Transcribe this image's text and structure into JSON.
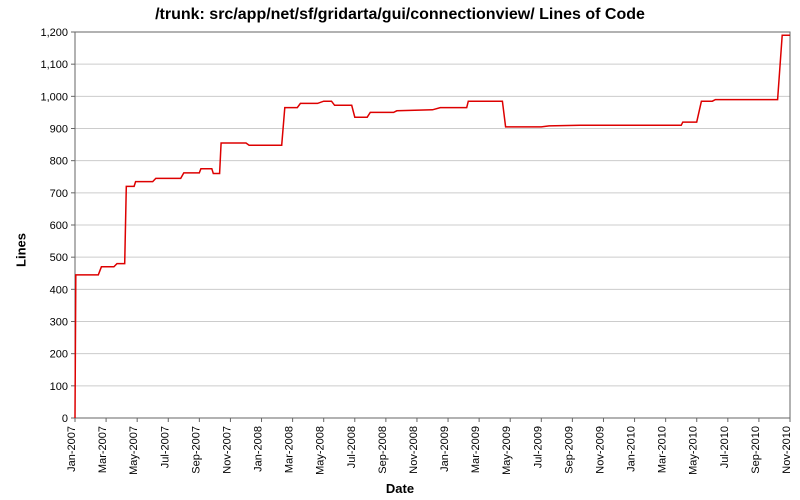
{
  "chart_data": {
    "type": "line",
    "title": "/trunk: src/app/net/sf/gridarta/gui/connectionview/ Lines of Code",
    "xlabel": "Date",
    "ylabel": "Lines",
    "ylim": [
      0,
      1200
    ],
    "yticks": [
      0,
      100,
      200,
      300,
      400,
      500,
      600,
      700,
      800,
      900,
      1000,
      1100,
      1200
    ],
    "ytick_labels": [
      "0",
      "100",
      "200",
      "300",
      "400",
      "500",
      "600",
      "700",
      "800",
      "900",
      "1,000",
      "1,100",
      "1,200"
    ],
    "xlim": [
      0,
      46
    ],
    "xticks": [
      0,
      2,
      4,
      6,
      8,
      10,
      12,
      14,
      16,
      18,
      20,
      22,
      24,
      26,
      28,
      30,
      32,
      34,
      36,
      38,
      40,
      42,
      44,
      46
    ],
    "xtick_labels": [
      "Jan-2007",
      "Mar-2007",
      "May-2007",
      "Jul-2007",
      "Sep-2007",
      "Nov-2007",
      "Jan-2008",
      "Mar-2008",
      "May-2008",
      "Jul-2008",
      "Sep-2008",
      "Nov-2008",
      "Jan-2009",
      "Mar-2009",
      "May-2009",
      "Jul-2009",
      "Sep-2009",
      "Nov-2009",
      "Jan-2010",
      "Mar-2010",
      "May-2010",
      "Jul-2010",
      "Sep-2010",
      "Nov-2010"
    ],
    "series": [
      {
        "name": "Lines of Code",
        "color": "#dd0000",
        "points": [
          {
            "x": 0.0,
            "y": 0
          },
          {
            "x": 0.05,
            "y": 445
          },
          {
            "x": 1.5,
            "y": 445
          },
          {
            "x": 1.7,
            "y": 470
          },
          {
            "x": 2.5,
            "y": 470
          },
          {
            "x": 2.7,
            "y": 480
          },
          {
            "x": 3.2,
            "y": 480
          },
          {
            "x": 3.3,
            "y": 720
          },
          {
            "x": 3.8,
            "y": 720
          },
          {
            "x": 3.9,
            "y": 735
          },
          {
            "x": 5.0,
            "y": 735
          },
          {
            "x": 5.2,
            "y": 745
          },
          {
            "x": 6.8,
            "y": 745
          },
          {
            "x": 7.0,
            "y": 762
          },
          {
            "x": 8.0,
            "y": 762
          },
          {
            "x": 8.1,
            "y": 775
          },
          {
            "x": 8.8,
            "y": 775
          },
          {
            "x": 8.9,
            "y": 760
          },
          {
            "x": 9.3,
            "y": 760
          },
          {
            "x": 9.4,
            "y": 855
          },
          {
            "x": 11.0,
            "y": 855
          },
          {
            "x": 11.2,
            "y": 848
          },
          {
            "x": 13.3,
            "y": 848
          },
          {
            "x": 13.5,
            "y": 965
          },
          {
            "x": 14.3,
            "y": 965
          },
          {
            "x": 14.5,
            "y": 978
          },
          {
            "x": 15.6,
            "y": 978
          },
          {
            "x": 16.0,
            "y": 985
          },
          {
            "x": 16.5,
            "y": 985
          },
          {
            "x": 16.7,
            "y": 972
          },
          {
            "x": 17.8,
            "y": 972
          },
          {
            "x": 18.0,
            "y": 935
          },
          {
            "x": 18.8,
            "y": 935
          },
          {
            "x": 19.0,
            "y": 950
          },
          {
            "x": 20.5,
            "y": 950
          },
          {
            "x": 20.7,
            "y": 955
          },
          {
            "x": 23.0,
            "y": 958
          },
          {
            "x": 23.5,
            "y": 965
          },
          {
            "x": 24.0,
            "y": 965
          },
          {
            "x": 25.2,
            "y": 965
          },
          {
            "x": 25.3,
            "y": 985
          },
          {
            "x": 27.5,
            "y": 985
          },
          {
            "x": 27.7,
            "y": 905
          },
          {
            "x": 30.0,
            "y": 905
          },
          {
            "x": 30.5,
            "y": 908
          },
          {
            "x": 32.5,
            "y": 910
          },
          {
            "x": 39.0,
            "y": 910
          },
          {
            "x": 39.1,
            "y": 920
          },
          {
            "x": 40.0,
            "y": 920
          },
          {
            "x": 40.3,
            "y": 985
          },
          {
            "x": 41.0,
            "y": 985
          },
          {
            "x": 41.2,
            "y": 990
          },
          {
            "x": 45.2,
            "y": 990
          },
          {
            "x": 45.5,
            "y": 1190
          },
          {
            "x": 46.0,
            "y": 1190
          }
        ]
      }
    ]
  }
}
